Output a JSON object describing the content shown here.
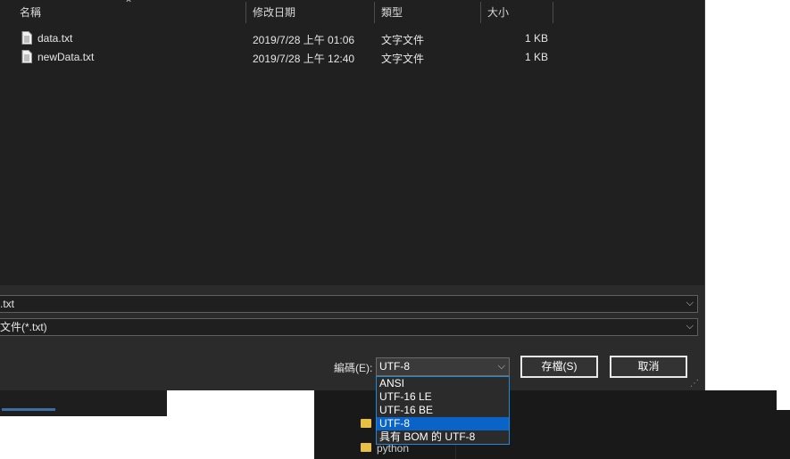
{
  "columns": {
    "name": "名稱",
    "modified": "修改日期",
    "type": "類型",
    "size": "大小"
  },
  "files": [
    {
      "name": "data.txt",
      "modified": "2019/7/28 上午 01:06",
      "type": "文字文件",
      "size": "1 KB",
      "icon": "text-file-icon"
    },
    {
      "name": "newData.txt",
      "modified": "2019/7/28 上午 12:40",
      "type": "文字文件",
      "size": "1 KB",
      "icon": "text-file-icon"
    }
  ],
  "fields": {
    "filename_value": ".txt",
    "filetype_value": "文件(*.txt)"
  },
  "encoding": {
    "label": "編碼(E):",
    "selected": "UTF-8",
    "options": [
      "ANSI",
      "UTF-16 LE",
      "UTF-16 BE",
      "UTF-8",
      "具有 BOM 的 UTF-8"
    ],
    "selected_index": 3
  },
  "buttons": {
    "save": "存檔(S)",
    "cancel": "取消"
  },
  "background": {
    "folder_label": "python"
  },
  "colors": {
    "dialog_bg": "#202020",
    "accent": "#0a64c8",
    "dropdown_border": "#1e8ad8"
  }
}
